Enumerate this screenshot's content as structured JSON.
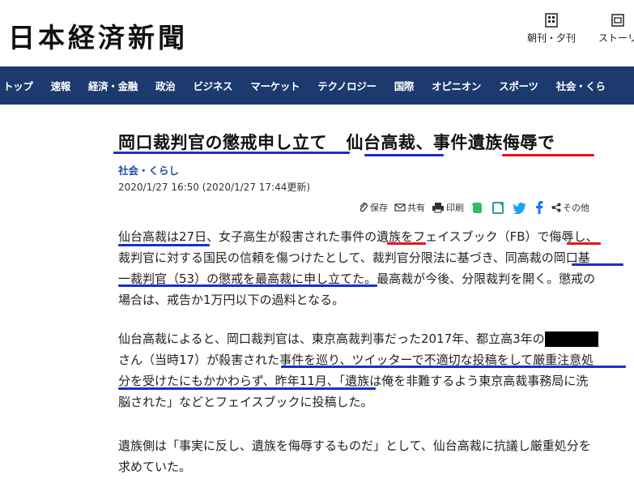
{
  "header": {
    "logo": "日本経済新聞",
    "edition_label": "朝刊・夕刊",
    "stories_label": "ストーリ"
  },
  "nav": [
    "トップ",
    "速報",
    "経済・金融",
    "政治",
    "ビジネス",
    "マーケット",
    "テクノロジー",
    "国際",
    "オピニオン",
    "スポーツ",
    "社会・くら"
  ],
  "article": {
    "headline_a": "岡口裁判官の懲戒申し立て",
    "headline_b": "仙台高裁",
    "headline_c": "、事件",
    "headline_d": "遺族侮辱で",
    "category": "社会・くらし",
    "timestamp": "2020/1/27 16:50 (2020/1/27 17:44更新)",
    "share": {
      "save": "保存",
      "share": "共有",
      "print": "印刷",
      "other": "その他"
    },
    "p1_lines": [
      "仙台高裁は27日、女子高生が殺害された事件の遺族をフェイスブック（FB）で侮辱し、",
      "裁判官に対する国民の信頼を傷つけたとして、裁判官分限法に基づき、同高裁の岡口基",
      "一裁判官（53）の懲戒を最高裁に申し立てた。最高裁が今後、分限裁判を開く。懲戒の",
      "場合は、戒告か1万円以下の過料となる。"
    ],
    "p2_line1": "仙台高裁によると、岡口裁判官は、東京高裁判事だった2017年、都立高3年の",
    "p2_lines": [
      "さん（当時17）が殺害された事件を巡り、ツイッターで不適切な投稿をして厳重注意処",
      "分を受けたにもかかわらず、昨年11月、「遺族は俺を非難するよう東京高裁事務局に洗",
      "脳された」などとフェイスブックに投稿した。"
    ],
    "p3_lines": [
      "遺族側は「事実に反し、遺族を侮辱するものだ」として、仙台高裁に抗議し厳重処分を",
      "求めていた。"
    ]
  },
  "colors": {
    "nav_bg": "#1d3a6e",
    "underline_blue": "#1a2fcc",
    "underline_red": "#e3141d",
    "category": "#1d4fa0"
  }
}
